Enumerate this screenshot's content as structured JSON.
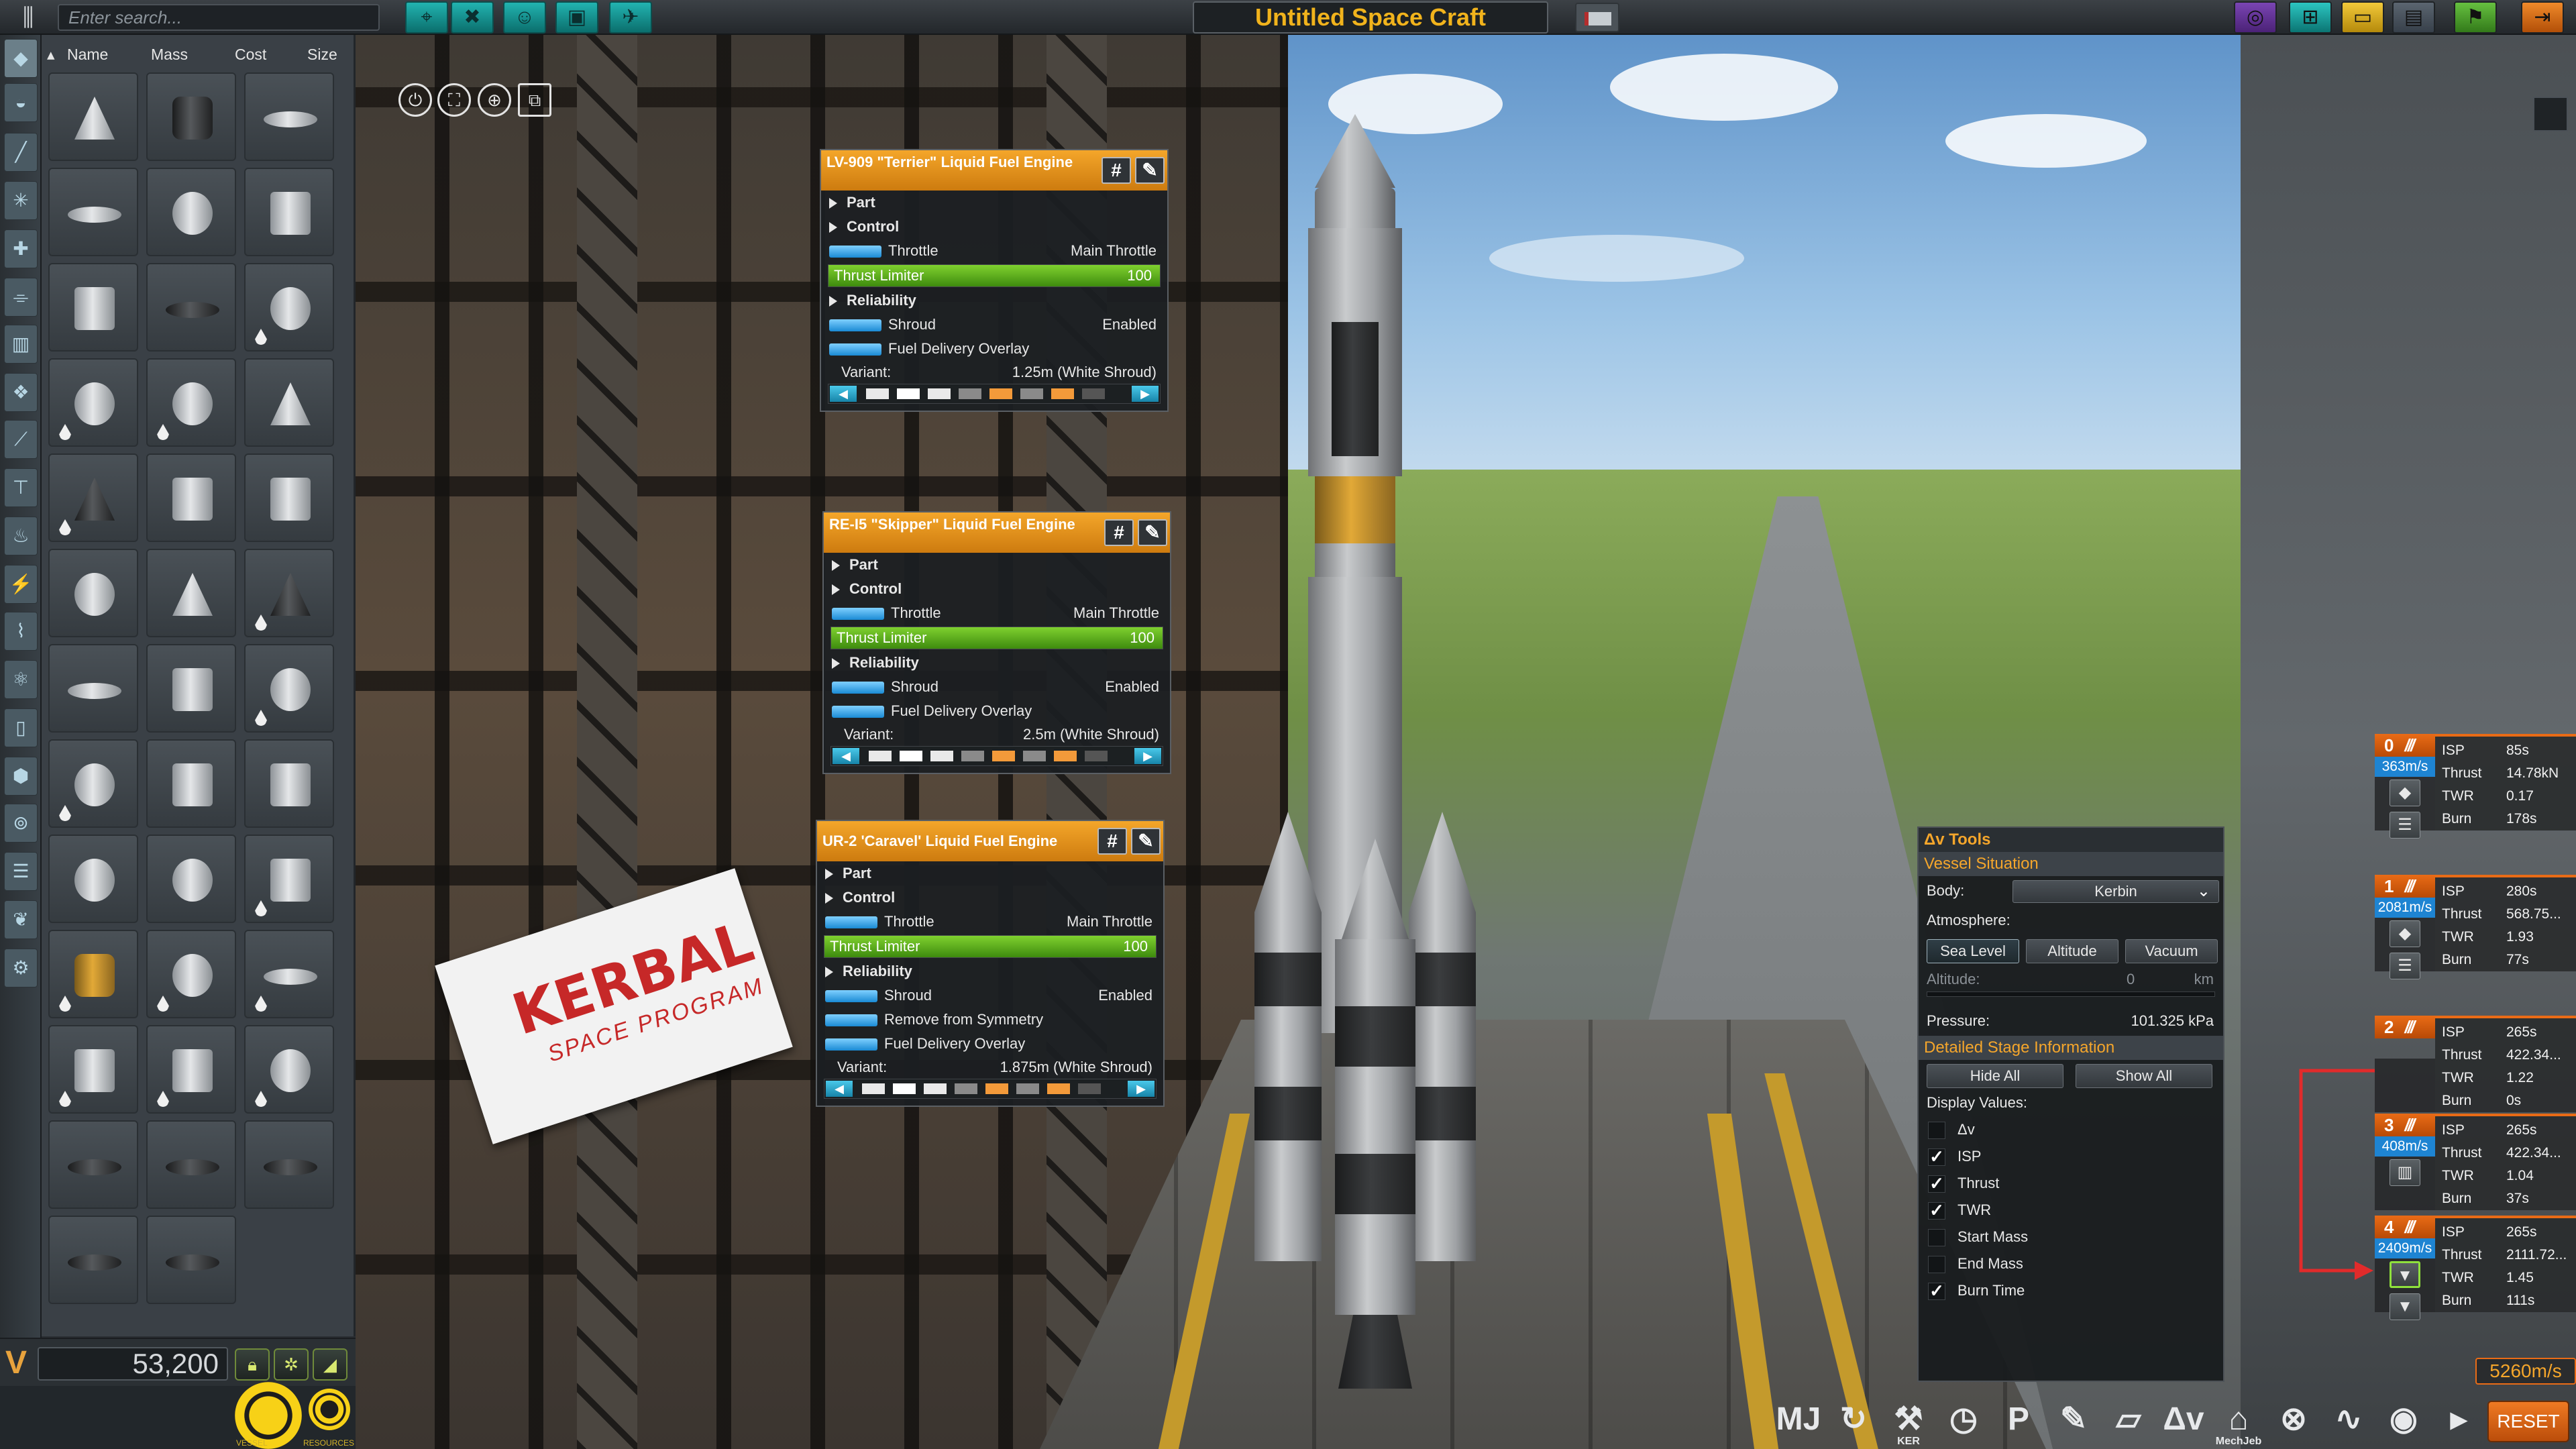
{
  "topbar": {
    "search_placeholder": "Enter search...",
    "menu_icon": "menu-toggle-icon",
    "editor_buttons": [
      "vab-icon",
      "action-groups-icon",
      "crew-icon",
      "cargo-icon",
      "engineer-icon"
    ],
    "craft_name": "Untitled Space Craft",
    "right_buttons": [
      "kspedia-icon",
      "new-craft-icon",
      "load-icon",
      "save-icon",
      "launch-icon",
      "exit-icon"
    ],
    "colors": {
      "craft_name": "#f1b31c",
      "editor_accent": "#22b3b0"
    }
  },
  "parts_panel": {
    "columns": [
      "Name",
      "Mass",
      "Cost",
      "Size"
    ],
    "categories": [
      "filter-icon",
      "pods-icon",
      "fuel-tank-icon",
      "engines-icon",
      "control-icon",
      "structural-icon",
      "coupling-icon",
      "payload-icon",
      "aero-icon",
      "ground-icon",
      "thermal-icon",
      "electrical-icon",
      "communication-icon",
      "science-icon",
      "cargo-icon",
      "utility-icon",
      "robotics-icon",
      "eva-icon",
      "misc-icon",
      "mods-icon"
    ],
    "parts": [
      {
        "shape": "cone",
        "drop": false
      },
      {
        "shape": "dark",
        "drop": false
      },
      {
        "shape": "disk",
        "drop": false
      },
      {
        "shape": "disk",
        "drop": false
      },
      {
        "shape": "round",
        "drop": false
      },
      {
        "shape": "box",
        "drop": false
      },
      {
        "shape": "box",
        "drop": false
      },
      {
        "shape": "disk dark",
        "drop": false
      },
      {
        "shape": "round",
        "drop": true
      },
      {
        "shape": "round",
        "drop": true
      },
      {
        "shape": "round",
        "drop": true
      },
      {
        "shape": "cone",
        "drop": false
      },
      {
        "shape": "cone dark",
        "drop": true
      },
      {
        "shape": "box",
        "drop": false
      },
      {
        "shape": "box",
        "drop": false
      },
      {
        "shape": "round",
        "drop": false
      },
      {
        "shape": "cone",
        "drop": false
      },
      {
        "shape": "cone dark",
        "drop": true
      },
      {
        "shape": "disk",
        "drop": false
      },
      {
        "shape": "box",
        "drop": false
      },
      {
        "shape": "round",
        "drop": true
      },
      {
        "shape": "round",
        "drop": true
      },
      {
        "shape": "box",
        "drop": false
      },
      {
        "shape": "box",
        "drop": false
      },
      {
        "shape": "round",
        "drop": false
      },
      {
        "shape": "round",
        "drop": false
      },
      {
        "shape": "box",
        "drop": true
      },
      {
        "shape": "gold",
        "drop": true
      },
      {
        "shape": "round",
        "drop": true
      },
      {
        "shape": "disk",
        "drop": true
      },
      {
        "shape": "box",
        "drop": true
      },
      {
        "shape": "box",
        "drop": true
      },
      {
        "shape": "round",
        "drop": true
      },
      {
        "shape": "disk dark",
        "drop": false
      },
      {
        "shape": "disk dark",
        "drop": false
      },
      {
        "shape": "disk dark",
        "drop": false
      },
      {
        "shape": "disk dark",
        "drop": false
      },
      {
        "shape": "disk dark",
        "drop": false
      }
    ]
  },
  "funds": {
    "value": "53,200"
  },
  "bottom_left": {
    "vessel_label": "VESSEL",
    "resources_label": "RESOURCES"
  },
  "part_windows": [
    {
      "title": "LV-909 \"Terrier\" Liquid Fuel Engine",
      "rows": [
        {
          "type": "fold",
          "label": "Part"
        },
        {
          "type": "fold",
          "label": "Control"
        },
        {
          "type": "toggle",
          "label": "Throttle",
          "value": "Main Throttle"
        },
        {
          "type": "slider",
          "label": "Thrust Limiter",
          "value": "100",
          "fill": 1.0
        },
        {
          "type": "fold",
          "label": "Reliability"
        },
        {
          "type": "toggle",
          "label": "Shroud",
          "value": "Enabled"
        },
        {
          "type": "toggle",
          "label": "Fuel Delivery Overlay",
          "value": ""
        }
      ],
      "variant_label": "Variant:",
      "variant_value": "1.25m (White Shroud)"
    },
    {
      "title": "RE-I5 \"Skipper\" Liquid Fuel Engine",
      "rows": [
        {
          "type": "fold",
          "label": "Part"
        },
        {
          "type": "fold",
          "label": "Control"
        },
        {
          "type": "toggle",
          "label": "Throttle",
          "value": "Main Throttle"
        },
        {
          "type": "slider",
          "label": "Thrust Limiter",
          "value": "100",
          "fill": 1.0
        },
        {
          "type": "fold",
          "label": "Reliability"
        },
        {
          "type": "toggle",
          "label": "Shroud",
          "value": "Enabled"
        },
        {
          "type": "toggle",
          "label": "Fuel Delivery Overlay",
          "value": ""
        }
      ],
      "variant_label": "Variant:",
      "variant_value": "2.5m (White Shroud)"
    },
    {
      "title": "UR-2 'Caravel' Liquid Fuel Engine",
      "rows": [
        {
          "type": "fold",
          "label": "Part"
        },
        {
          "type": "fold",
          "label": "Control"
        },
        {
          "type": "toggle",
          "label": "Throttle",
          "value": "Main Throttle"
        },
        {
          "type": "slider",
          "label": "Thrust Limiter",
          "value": "100",
          "fill": 1.0
        },
        {
          "type": "fold",
          "label": "Reliability"
        },
        {
          "type": "toggle",
          "label": "Shroud",
          "value": "Enabled"
        },
        {
          "type": "toggle",
          "label": "Remove from Symmetry",
          "value": ""
        },
        {
          "type": "toggle",
          "label": "Fuel Delivery Overlay",
          "value": ""
        }
      ],
      "variant_label": "Variant:",
      "variant_value": "1.875m (White Shroud)"
    }
  ],
  "banner": {
    "title": "KERBAL",
    "subtitle": "SPACE PROGRAM"
  },
  "dv_tools": {
    "title": "Δv Tools",
    "vessel_situation": "Vessel Situation",
    "body_label": "Body:",
    "body_value": "Kerbin",
    "atmosphere_label": "Atmosphere:",
    "atm_buttons": [
      "Sea Level",
      "Altitude",
      "Vacuum"
    ],
    "atm_selected": "Sea Level",
    "altitude_label": "Altitude:",
    "altitude_value": "0",
    "altitude_unit": "km",
    "pressure_label": "Pressure:",
    "pressure_value": "101.325 kPa",
    "detailed_stage_info": "Detailed Stage Information",
    "hide_all": "Hide All",
    "show_all": "Show All",
    "display_values_label": "Display Values:",
    "display_values": [
      {
        "label": "Δv",
        "checked": false
      },
      {
        "label": "ISP",
        "checked": true
      },
      {
        "label": "Thrust",
        "checked": true
      },
      {
        "label": "TWR",
        "checked": true
      },
      {
        "label": "Start Mass",
        "checked": false
      },
      {
        "label": "End Mass",
        "checked": false
      },
      {
        "label": "Burn Time",
        "checked": true
      }
    ]
  },
  "stages": [
    {
      "num": "0",
      "dv": "363m/s",
      "isp": "85s",
      "thrust": "14.78kN",
      "twr": "0.17",
      "burn": "178s",
      "icons": [
        "decoupler-icon",
        "parachute-icon"
      ]
    },
    {
      "num": "1",
      "dv": "2081m/s",
      "isp": "280s",
      "thrust": "568.75...",
      "twr": "1.93",
      "burn": "77s",
      "icons": [
        "decoupler-icon",
        "parachute-icon"
      ]
    },
    {
      "num": "2",
      "dv": "",
      "isp": "265s",
      "thrust": "422.34...",
      "twr": "1.22",
      "burn": "0s",
      "icons": []
    },
    {
      "num": "3",
      "dv": "408m/s",
      "isp": "265s",
      "thrust": "422.34...",
      "twr": "1.04",
      "burn": "37s",
      "icons": [
        "engine-cluster-icon"
      ]
    },
    {
      "num": "4",
      "dv": "2409m/s",
      "isp": "265s",
      "thrust": "2111.72...",
      "twr": "1.45",
      "burn": "111s",
      "icons": [
        "engine-icon",
        "engine-icon"
      ]
    }
  ],
  "stage_labels": {
    "isp": "ISP",
    "thrust": "Thrust",
    "twr": "TWR",
    "burn": "Burn"
  },
  "total_dv": "5260m/s",
  "app_bar": [
    {
      "icon": "mechjeb-icon",
      "text": "MJ",
      "label": ""
    },
    {
      "icon": "undo-icon",
      "text": "↻",
      "label": ""
    },
    {
      "icon": "ker-icon",
      "text": "⚒",
      "label": "KER"
    },
    {
      "icon": "alarm-clock-icon",
      "text": "◷",
      "label": ""
    },
    {
      "icon": "parking-icon",
      "text": "P",
      "label": ""
    },
    {
      "icon": "wrench-icon",
      "text": "✎",
      "label": ""
    },
    {
      "icon": "editor-icon",
      "text": "▱",
      "label": ""
    },
    {
      "icon": "delta-v-icon",
      "text": "Δv",
      "label": ""
    },
    {
      "icon": "mechjeb-hat-icon",
      "text": "⌂",
      "label": "MechJeb"
    },
    {
      "icon": "radar-icon",
      "text": "⊗",
      "label": ""
    },
    {
      "icon": "telemetry-icon",
      "text": "∿",
      "label": ""
    },
    {
      "icon": "signal-icon",
      "text": "◉",
      "label": ""
    },
    {
      "icon": "expand-arrow-icon",
      "text": "▸",
      "label": ""
    }
  ],
  "reset_label": "RESET"
}
